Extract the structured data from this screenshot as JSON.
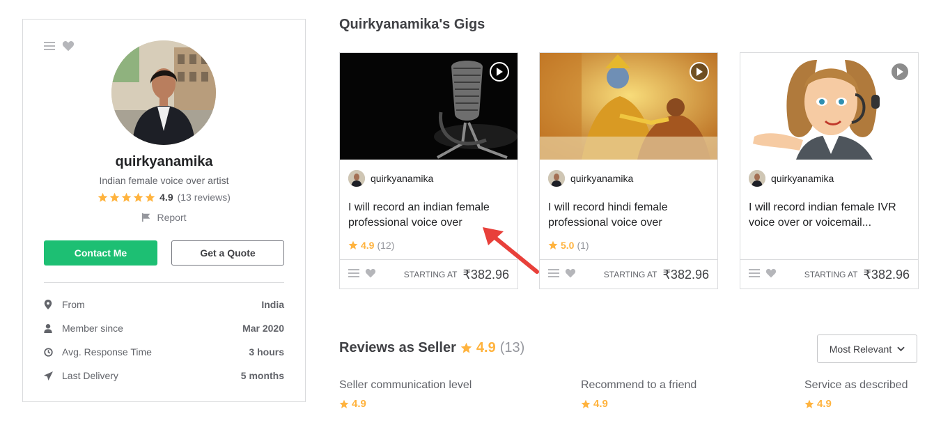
{
  "colors": {
    "accent": "#1dbf73",
    "star": "#ffb33e",
    "arrow": "#e8403a"
  },
  "seller": {
    "name": "quirkyanamika",
    "tagline": "Indian female voice over artist",
    "rating": "4.9",
    "reviews_text": "(13 reviews)",
    "report_label": "Report",
    "contact_label": "Contact Me",
    "quote_label": "Get a Quote",
    "stats": [
      {
        "icon": "location-pin-icon",
        "label": "From",
        "value": "India"
      },
      {
        "icon": "user-icon",
        "label": "Member since",
        "value": "Mar 2020"
      },
      {
        "icon": "clock-icon",
        "label": "Avg. Response Time",
        "value": "3 hours"
      },
      {
        "icon": "paper-plane-icon",
        "label": "Last Delivery",
        "value": "5 months"
      }
    ]
  },
  "gigs_title": "Quirkyanamika's Gigs",
  "gigs": [
    {
      "seller": "quirkyanamika",
      "title": "I will record an indian female professional voice over",
      "rating": "4.9",
      "count": "(12)",
      "starting_label": "STARTING AT",
      "price": "₹382.96",
      "thumb": "microphone"
    },
    {
      "seller": "quirkyanamika",
      "title": "I will record hindi female professional voice over",
      "rating": "5.0",
      "count": "(1)",
      "starting_label": "STARTING AT",
      "price": "₹382.96",
      "thumb": "krishna-painting"
    },
    {
      "seller": "quirkyanamika",
      "title": "I will record indian female IVR voice over or voicemail...",
      "rating": "",
      "count": "",
      "starting_label": "STARTING AT",
      "price": "₹382.96",
      "thumb": "cartoon-call-agent"
    }
  ],
  "reviews": {
    "title": "Reviews as Seller",
    "score": "4.9",
    "count": "(13)",
    "sort_label": "Most Relevant",
    "breakdown": [
      {
        "label": "Seller communication level",
        "value": "4.9"
      },
      {
        "label": "Recommend to a friend",
        "value": "4.9"
      },
      {
        "label": "Service as described",
        "value": "4.9"
      }
    ]
  }
}
